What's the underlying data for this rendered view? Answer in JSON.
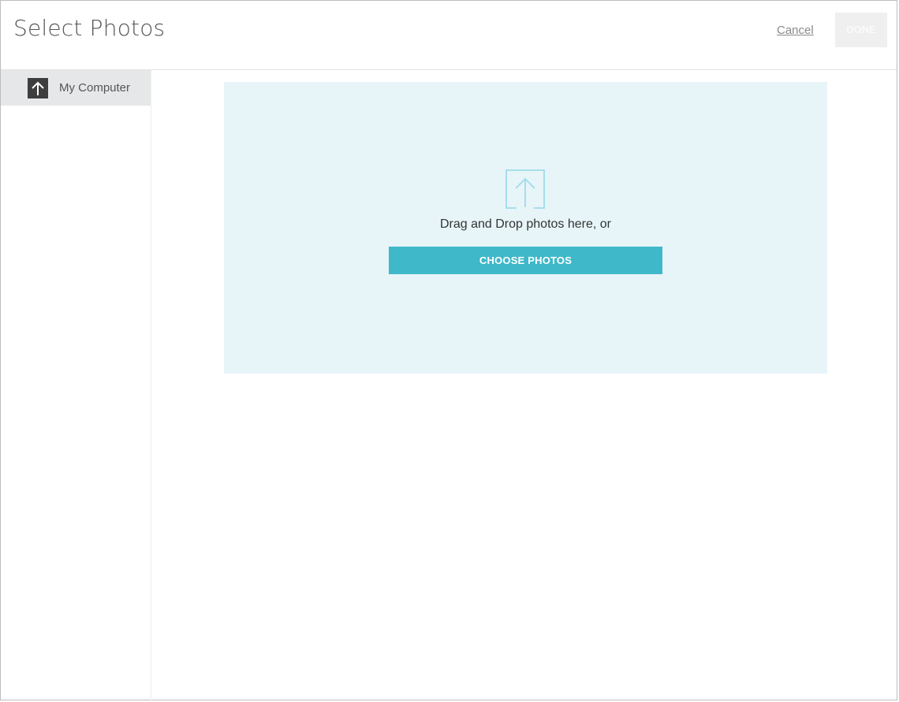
{
  "header": {
    "title": "Select Photos",
    "cancel_label": "Cancel",
    "done_label": "DONE"
  },
  "sidebar": {
    "items": [
      {
        "label": "My Computer",
        "icon": "upload-arrow-icon"
      }
    ]
  },
  "dropzone": {
    "icon": "upload-icon",
    "text": "Drag and Drop photos here, or",
    "button_label": "CHOOSE PHOTOS"
  },
  "colors": {
    "accent": "#3fb8c9",
    "dropzone_bg": "#e7f5f9",
    "sidebar_active": "#e6e7e8",
    "done_disabled": "#efefef"
  }
}
